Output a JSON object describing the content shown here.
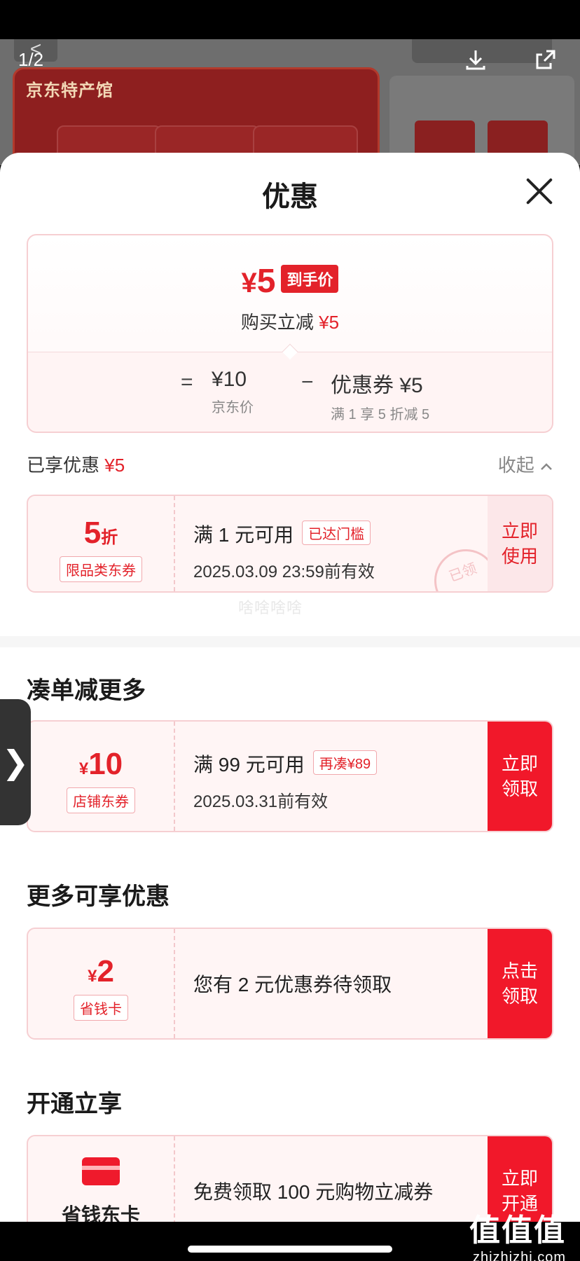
{
  "background": {
    "image_counter": "1/2",
    "banner_brand": "京东特产馆",
    "back_glyph": "<",
    "download_icon": "download-icon",
    "share_icon": "share-icon"
  },
  "sheet": {
    "title": "优惠",
    "close_icon": "close-icon"
  },
  "price_summary": {
    "currency": "¥",
    "final_price": "5",
    "final_tag": "到手价",
    "subtitle_prefix": "购买立减",
    "subtitle_amount": "¥5",
    "equals": "=",
    "base_value": "¥10",
    "base_label": "京东价",
    "minus": "−",
    "discount_value": "优惠券 ¥5",
    "discount_label": "满 1 享 5 折减 5"
  },
  "enjoyed": {
    "label": "已享优惠",
    "amount": "¥5",
    "collapse_label": "收起"
  },
  "coupons": {
    "enjoyed_coupon": {
      "value": "5",
      "unit": "折",
      "type": "限品类东券",
      "condition": "满 1 元可用",
      "chip": "已达门槛",
      "expiry": "2025.03.09 23:59前有效",
      "action_line1": "立即",
      "action_line2": "使用",
      "stamp": "已领"
    },
    "watermark": "啥啥啥啥",
    "more_section_title": "凑单减更多",
    "shop_coupon": {
      "currency": "¥",
      "value": "10",
      "type": "店铺东券",
      "condition": "满 99 元可用",
      "chip": "再凑¥89",
      "expiry": "2025.03.31前有效",
      "action_line1": "立即",
      "action_line2": "领取"
    },
    "extra_section_title": "更多可享优惠",
    "saver_card": {
      "currency": "¥",
      "value": "2",
      "type": "省钱卡",
      "text": "您有 2 元优惠券待领取",
      "action_line1": "点击",
      "action_line2": "领取"
    },
    "open_section_title": "开通立享",
    "open_card": {
      "icon": "card-icon",
      "name": "省钱东卡",
      "text": "免费领取 100 元购物立减券",
      "action_line1": "立即",
      "action_line2": "开通"
    }
  },
  "side_handle_glyph": "❯",
  "site_mark": {
    "big": "值值值",
    "small": "zhizhizhi.com"
  },
  "colors": {
    "accent_red": "#e3222a",
    "button_red": "#f1182a",
    "soft_pink": "#fff5f5"
  }
}
